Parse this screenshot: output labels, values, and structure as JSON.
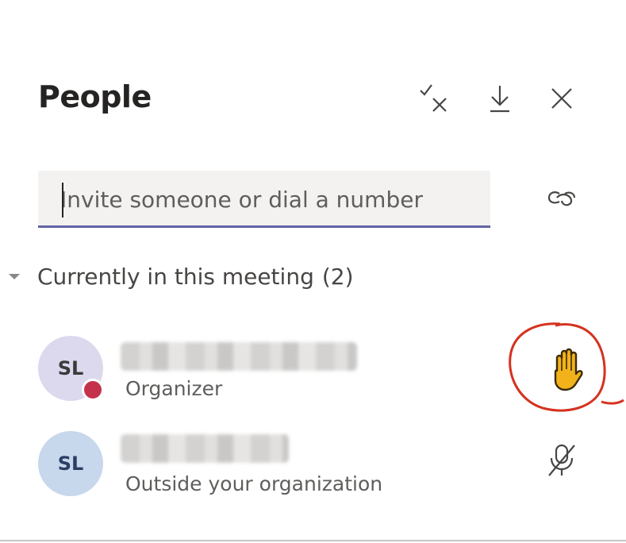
{
  "panel": {
    "title": "People",
    "header_actions": [
      {
        "name": "mute-all-icon"
      },
      {
        "name": "download-icon"
      },
      {
        "name": "close-icon"
      }
    ]
  },
  "invite": {
    "placeholder": "Invite someone or dial a number",
    "value": ""
  },
  "share_link": {
    "icon": "link-icon"
  },
  "section": {
    "label": "Currently in this meeting",
    "count": "(2)"
  },
  "participants": [
    {
      "initials": "SL",
      "role": "Organizer",
      "status_color": "#c4314b",
      "action_icon": "raised-hand-icon"
    },
    {
      "initials": "SL",
      "role": "Outside your organization",
      "action_icon": "mic-off-icon"
    }
  ],
  "colors": {
    "accent": "#6264a7",
    "hand": "#f2b31a",
    "annotation": "#d5321f"
  }
}
